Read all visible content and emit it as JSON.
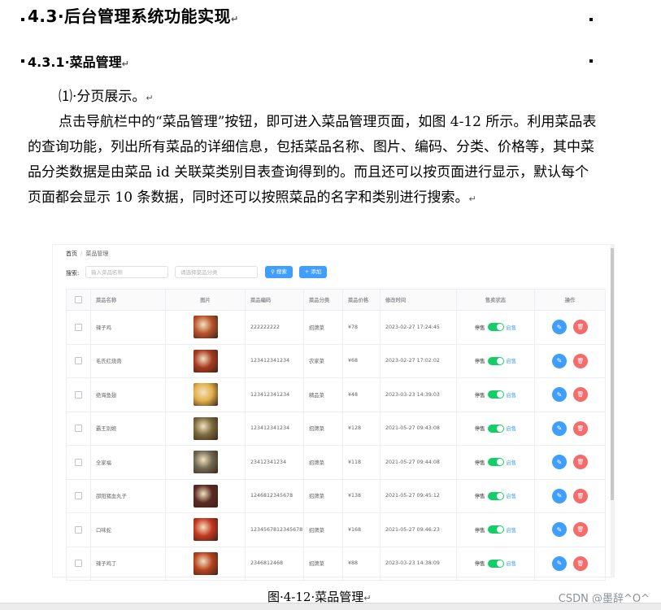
{
  "heading": {
    "number": "4.3",
    "title": "后台管理系统功能实现",
    "mark": "↵"
  },
  "subheading": {
    "number": "4.3.1",
    "title": "菜品管理",
    "mark": "↵"
  },
  "item": {
    "label": "⑴",
    "text": "分页展示。",
    "mark": "↵"
  },
  "paragraph": "点击导航栏中的“菜品管理”按钮，即可进入菜品管理页面，如图 4-12 所示。利用菜品表的查询功能，列出所有菜品的详细信息，包括菜品名称、图片、编码、分类、价格等，其中菜品分类数据是由菜品 id 关联菜类别目表查询得到的。而且还可以按页面进行显示，默认每个页面都会显示 10 条数据，同时还可以按照菜品的名字和类别进行搜索。",
  "paragraph_mark": "↵",
  "screenshot": {
    "breadcrumb": {
      "home": "首页",
      "separator": "/",
      "current": "菜品管理"
    },
    "search_label": "搜索:",
    "name_placeholder": "输入菜品名称",
    "category_placeholder": "请选择菜品分类",
    "search_button": "搜索",
    "add_button": "添加",
    "columns": [
      "菜品名称",
      "图片",
      "菜品编码",
      "菜品分类",
      "菜品价格",
      "修改时间",
      "售卖状态",
      "操作"
    ],
    "rows": [
      {
        "name": "辣子鸡",
        "code": "222222222",
        "category": "招牌菜",
        "price": "¥78",
        "time": "2023-02-27 17:24:45",
        "img": "#b9532c"
      },
      {
        "name": "毛氏红烧肉",
        "code": "123412341234",
        "category": "农家菜",
        "price": "¥68",
        "time": "2023-02-27 17:02:02",
        "img": "#a83a20"
      },
      {
        "name": "绝海鱼翅",
        "code": "123412341234",
        "category": "精品菜",
        "price": "¥48",
        "time": "2023-03-23 14:39:03",
        "img": "#e3b04a"
      },
      {
        "name": "霸王别姬",
        "code": "123412341234",
        "category": "招牌菜",
        "price": "¥128",
        "time": "2021-05-27 09:43:08",
        "img": "#7a6a3c"
      },
      {
        "name": "全家福",
        "code": "23412341234",
        "category": "招牌菜",
        "price": "¥118",
        "time": "2021-05-27 09:44:08",
        "img": "#6f6a52"
      },
      {
        "name": "邵阳猪血丸子",
        "code": "1246812345678",
        "category": "招牌菜",
        "price": "¥138",
        "time": "2021-05-27 09:45:12",
        "img": "#5a2a22"
      },
      {
        "name": "口味蛇",
        "code": "1234567812345678",
        "category": "招牌菜",
        "price": "¥168",
        "time": "2021-05-27 09:46:23",
        "img": "#c5371f"
      },
      {
        "name": "辣子鸡丁",
        "code": "2346812468",
        "category": "招牌菜",
        "price": "¥88",
        "time": "2023-03-23 14:38:09",
        "img": "#b8431f"
      }
    ],
    "status_off": "停售",
    "status_on": "启售",
    "edit_icon": "✎",
    "delete_icon": "🗑"
  },
  "caption": "图·4-12·菜品管理",
  "caption_mark": "↵",
  "watermark": "CSDN @墨辞^O^",
  "colors": {
    "accent": "#409eff",
    "switch_on": "#13ce66",
    "danger": "#f56c6c"
  }
}
